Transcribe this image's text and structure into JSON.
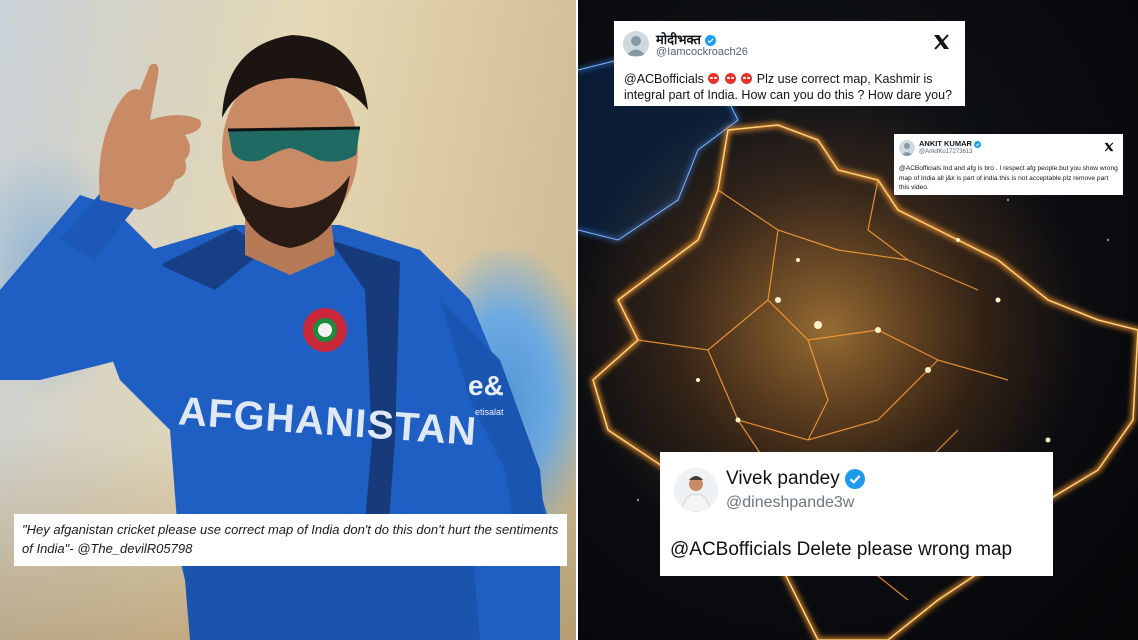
{
  "left": {
    "caption": "\"Hey afganistan cricket please use correct map of India don't do this don't hurt the sentiments of India\"- @The_devilR05798",
    "jersey_text": "AFGHANISTAN"
  },
  "tweets": [
    {
      "name": "मोदीभक्त",
      "handle": "@Iamcockroach26",
      "verified": true,
      "text_start": "@ACBofficials",
      "emoji": [
        "angry-face",
        "angry-face",
        "angry-face"
      ],
      "text_end": "Plz use correct map, Kashmir is integral part of India. How can you do this ? How dare you?",
      "x_logo": "x-logo"
    },
    {
      "name": "ANKIT KUMAR",
      "handle": "@AnkitKu17273613",
      "verified": true,
      "text": "@ACBofficials Ind and afg is bro . I respect afg people.but you show wrong map of India all j&k is part of india.this is not acceptable.plz remove part this video.",
      "x_logo": "x-logo"
    },
    {
      "name": "Vivek pandey",
      "handle": "@dineshpande3w",
      "verified": true,
      "text": "@ACBofficials Delete please wrong map"
    }
  ],
  "colors": {
    "jersey_blue": "#1f5fc4",
    "map_glow": "#ff9a2e",
    "border_blue": "#3b8cff",
    "verified": "#1d9bf0"
  }
}
